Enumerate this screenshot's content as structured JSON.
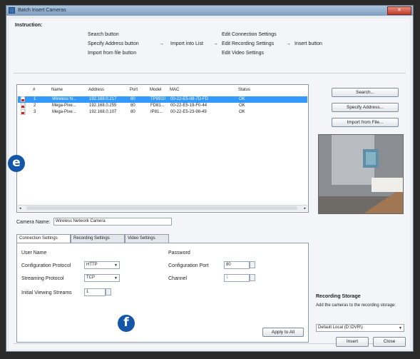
{
  "window": {
    "title": "Batch Insert Cameras",
    "close": "✕"
  },
  "instruction": {
    "heading": "Instruction:",
    "col1": [
      "Search button",
      "Specify Address button",
      "Import from file button"
    ],
    "arrow1": "→",
    "middle": "Import into List",
    "arrow2": "→",
    "col2": [
      "Edit Connection Settings",
      "Edit Recording Settings",
      "Edit Video Settings"
    ],
    "arrow3": "→",
    "end": "Insert button"
  },
  "list": {
    "headers": [
      "#",
      "Name",
      "Address",
      "Port",
      "Model",
      "MAC",
      "Status"
    ],
    "rows": [
      {
        "n": "1",
        "name": "Wireless N...",
        "address": "192.168.0.217",
        "port": "80",
        "model": "TP9910",
        "mac": "00-22-E5-08-7D-FD",
        "status": "OK",
        "selected": true
      },
      {
        "n": "2",
        "name": "Mega-Pixe...",
        "address": "192.168.0.255",
        "port": "80",
        "model": "FD81...",
        "mac": "00-22-E5-19-F0-44",
        "status": "OK",
        "selected": false
      },
      {
        "n": "3",
        "name": "Mega-Pixe...",
        "address": "192.168.0.107",
        "port": "80",
        "model": "IP81...",
        "mac": "00-22-E5-23-98-49",
        "status": "OK",
        "selected": false
      }
    ]
  },
  "buttons": {
    "search": "Search...",
    "specify": "Specify Address...",
    "import": "Import from File...",
    "apply_all": "Apply to All",
    "insert": "Insert",
    "close": "Close"
  },
  "badges": {
    "e": "e",
    "f": "f"
  },
  "camera": {
    "name_label": "Camera Name:",
    "name_value": "Wireless Network Camera"
  },
  "tabs": [
    "Connection Settings",
    "Recording Settings",
    "Video Settings"
  ],
  "connection": {
    "user_label": "User Name",
    "password_label": "Password",
    "config_protocol_label": "Configuration Protocol",
    "config_protocol_value": "HTTP",
    "config_port_label": "Configuration Port",
    "config_port_value": "80",
    "streaming_protocol_label": "Streaming Protocol",
    "streaming_protocol_value": "TCP",
    "channel_label": "Channel",
    "channel_value": "1",
    "streams_label": "Initial Viewing Streams",
    "streams_value": "1"
  },
  "storage": {
    "heading": "Recording Storage",
    "desc": "Add the cameras to the recording storage:",
    "value": "Default Local (D:\\DVR\\)"
  },
  "colors": {
    "selection": "#3399ff",
    "badge": "#1556a8"
  }
}
